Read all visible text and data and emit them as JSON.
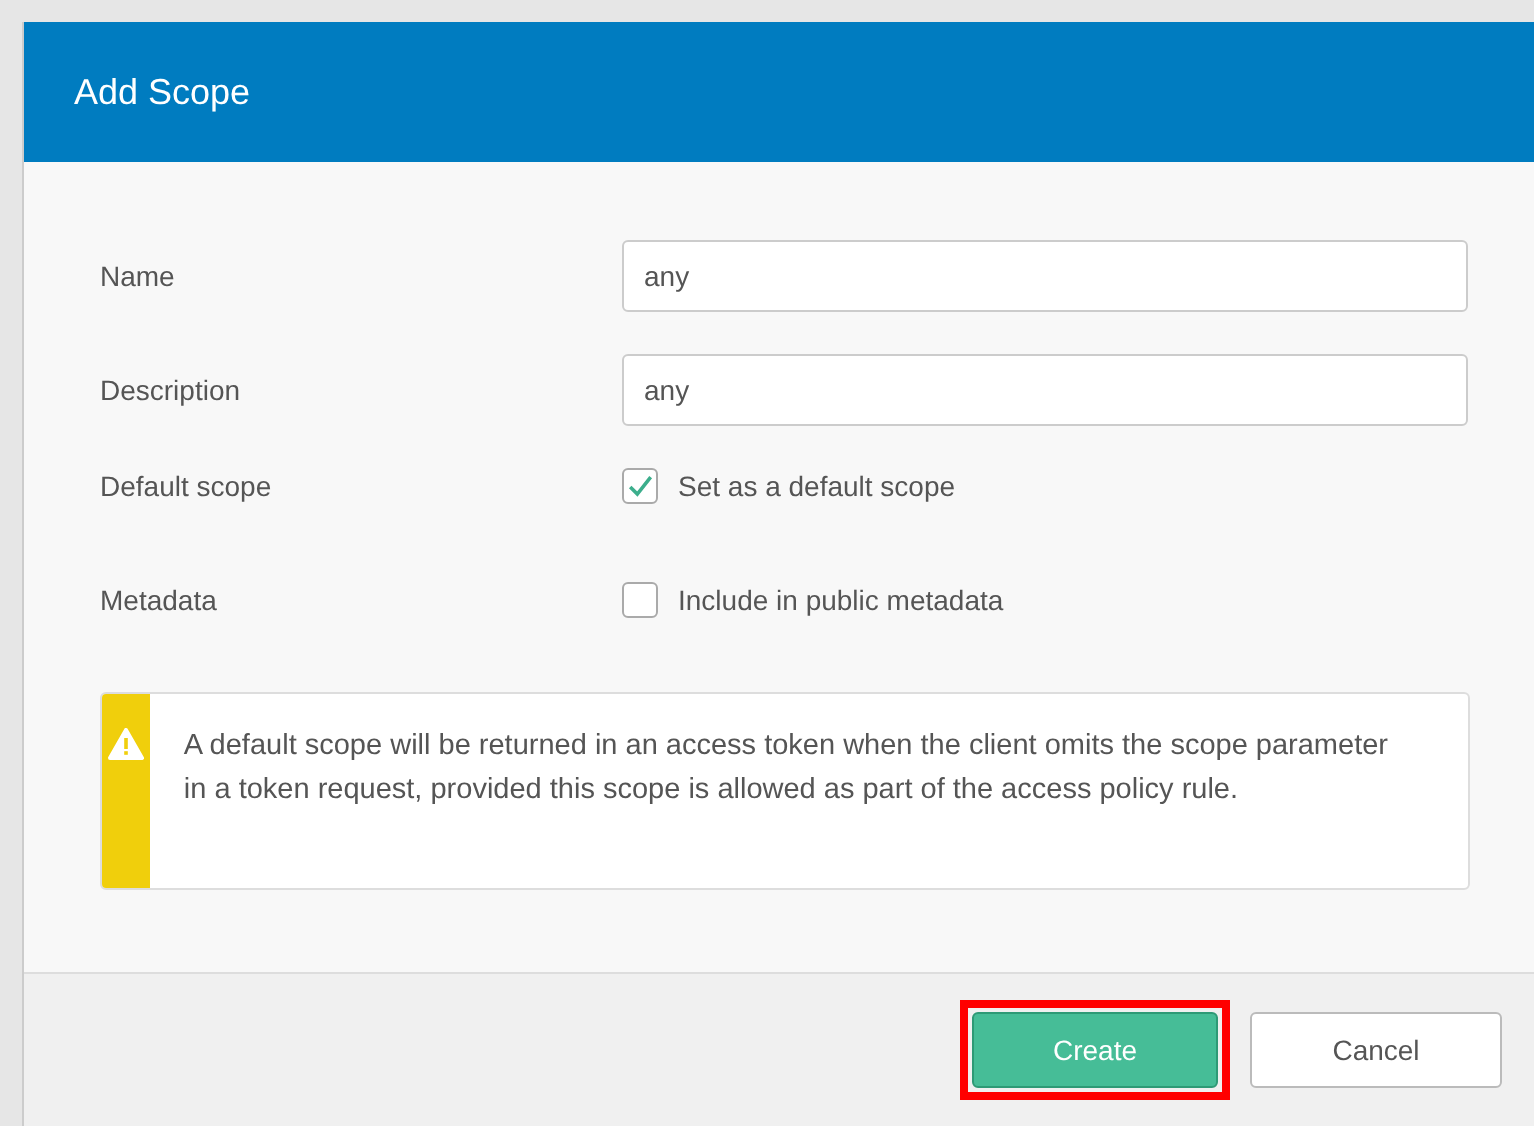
{
  "dialog": {
    "title": "Add Scope"
  },
  "fields": [
    {
      "kind": "text",
      "label": "Name",
      "value": "any"
    },
    {
      "kind": "text",
      "label": "Description",
      "value": "any"
    },
    {
      "kind": "checkbox",
      "label": "Default scope",
      "option": "Set as a default scope",
      "checked": true
    },
    {
      "kind": "checkbox",
      "label": "Metadata",
      "option": "Include in public metadata",
      "checked": false
    }
  ],
  "alert": {
    "text": "A default scope will be returned in an access token when the client omits the scope parameter in a token request, provided this scope is allowed as part of the access policy rule."
  },
  "buttons": [
    {
      "label": "Create",
      "kind": "primary",
      "highlighted": true
    },
    {
      "label": "Cancel",
      "kind": "secondary",
      "highlighted": false
    }
  ]
}
